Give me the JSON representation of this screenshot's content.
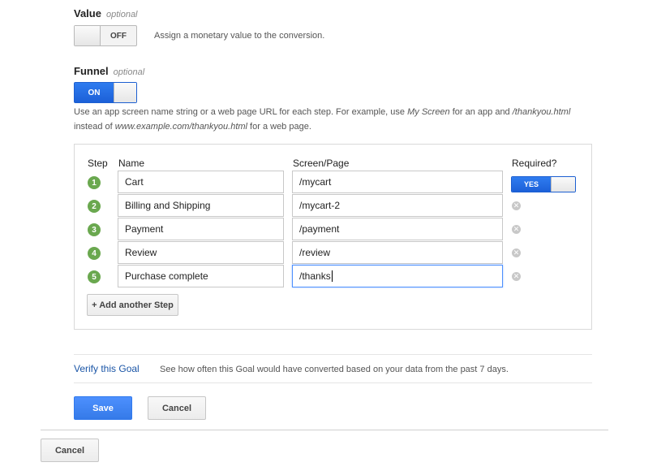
{
  "value": {
    "label": "Value",
    "optional": "optional",
    "toggle": "OFF",
    "description": "Assign a monetary value to the conversion."
  },
  "funnel": {
    "label": "Funnel",
    "optional": "optional",
    "toggle": "ON",
    "help_1": "Use an app screen name string or a web page URL for each step. For example, use ",
    "help_em1": "My Screen",
    "help_2": " for an app and ",
    "help_em2": "/thankyou.html",
    "help_3": "instead of ",
    "help_em3": "www.example.com/thankyou.html",
    "help_4": " for a web page."
  },
  "table": {
    "headers": {
      "step": "Step",
      "name": "Name",
      "page": "Screen/Page",
      "required": "Required?"
    },
    "required_toggle": "YES",
    "steps": [
      {
        "num": "1",
        "name": "Cart",
        "page": "/mycart"
      },
      {
        "num": "2",
        "name": "Billing and Shipping",
        "page": "/mycart-2"
      },
      {
        "num": "3",
        "name": "Payment",
        "page": "/payment"
      },
      {
        "num": "4",
        "name": "Review",
        "page": "/review"
      },
      {
        "num": "5",
        "name": "Purchase complete",
        "page": "/thanks"
      }
    ],
    "add_step": "+ Add another Step"
  },
  "verify": {
    "link": "Verify this Goal",
    "description": "See how often this Goal would have converted based on your data from the past 7 days."
  },
  "buttons": {
    "save": "Save",
    "cancel": "Cancel",
    "cancel_outer": "Cancel"
  }
}
